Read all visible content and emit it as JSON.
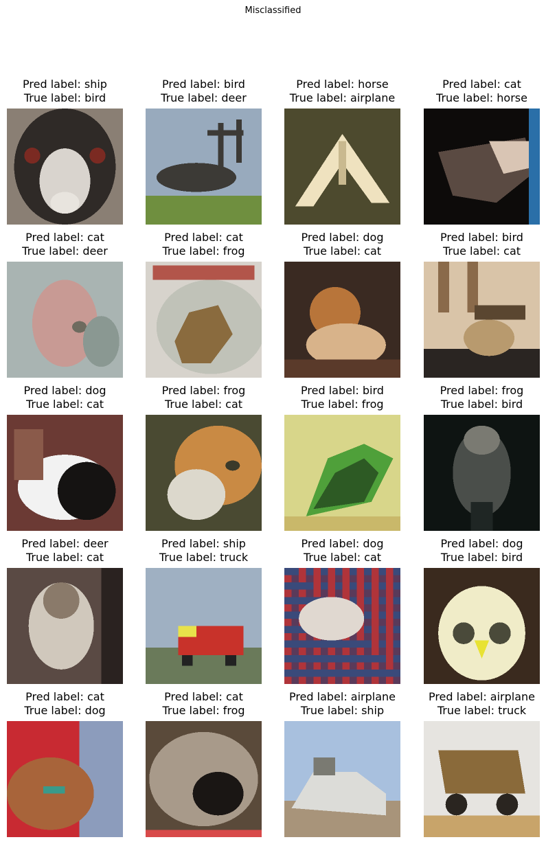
{
  "figure": {
    "title": "Misclassified"
  },
  "images": [
    {
      "pred": "Pred label: ship",
      "true": "True label: bird",
      "scene": "ostrich",
      "colors": [
        "#8a7f74",
        "#2f2a27",
        "#d9d4ce",
        "#7b2a22"
      ]
    },
    {
      "pred": "Pred label: bird",
      "true": "True label: deer",
      "scene": "deer-silhouette",
      "colors": [
        "#98aabd",
        "#3c3a36",
        "#6f8f3f",
        "#dfe4ea"
      ]
    },
    {
      "pred": "Pred label: horse",
      "true": "True label: airplane",
      "scene": "stealth-plane",
      "colors": [
        "#4d4a2e",
        "#efe2bf",
        "#6e6940",
        "#c9b98f"
      ]
    },
    {
      "pred": "Pred label: cat",
      "true": "True label: horse",
      "scene": "horse-head",
      "colors": [
        "#0d0b0a",
        "#5a4a42",
        "#d9c5b4",
        "#2a6fa8"
      ]
    },
    {
      "pred": "Pred label: cat",
      "true": "True label: deer",
      "scene": "deer-face",
      "colors": [
        "#a9b4b2",
        "#c89a94",
        "#8a9892",
        "#6e6b5f"
      ]
    },
    {
      "pred": "Pred label: cat",
      "true": "True label: frog",
      "scene": "frog-plate",
      "colors": [
        "#d7d3cc",
        "#8a6b3e",
        "#c0c2b8",
        "#b2554a"
      ]
    },
    {
      "pred": "Pred label: dog",
      "true": "True label: cat",
      "scene": "cat-sitting",
      "colors": [
        "#3a2a22",
        "#b8753a",
        "#d8b38a",
        "#5a3a2a"
      ]
    },
    {
      "pred": "Pred label: bird",
      "true": "True label: cat",
      "scene": "cat-window",
      "colors": [
        "#d9c4a8",
        "#5a4630",
        "#b89a6e",
        "#2a2522"
      ]
    },
    {
      "pred": "Pred label: dog",
      "true": "True label: cat",
      "scene": "cat-bw",
      "colors": [
        "#6b3a34",
        "#f2f2f2",
        "#151312",
        "#8a5a4a"
      ]
    },
    {
      "pred": "Pred label: frog",
      "true": "True label: cat",
      "scene": "cat-orange",
      "colors": [
        "#4a4a32",
        "#c98a44",
        "#dcd8cc",
        "#6a6a4a"
      ]
    },
    {
      "pred": "Pred label: bird",
      "true": "True label: frog",
      "scene": "frog-green",
      "colors": [
        "#d8d68a",
        "#4fa03a",
        "#2d5a24",
        "#c9b86a"
      ]
    },
    {
      "pred": "Pred label: frog",
      "true": "True label: bird",
      "scene": "hawk-dark",
      "colors": [
        "#0e1412",
        "#4a4e4a",
        "#7a7a72",
        "#1f2624"
      ]
    },
    {
      "pred": "Pred label: deer",
      "true": "True label: cat",
      "scene": "cat-grey",
      "colors": [
        "#5a4a44",
        "#d0c8bc",
        "#8a7a6a",
        "#2a2220"
      ]
    },
    {
      "pred": "Pred label: ship",
      "true": "True label: truck",
      "scene": "truck-red",
      "colors": [
        "#9fb0c2",
        "#c8322a",
        "#6a7a5a",
        "#e8e24a"
      ]
    },
    {
      "pred": "Pred label: dog",
      "true": "True label: cat",
      "scene": "cat-plaid",
      "colors": [
        "#5a3a5a",
        "#b0343a",
        "#e0d8d0",
        "#3a4a7a"
      ]
    },
    {
      "pred": "Pred label: dog",
      "true": "True label: bird",
      "scene": "owl",
      "colors": [
        "#3a2a1e",
        "#f0ecc8",
        "#e8e234",
        "#6a5a40"
      ]
    },
    {
      "pred": "Pred label: cat",
      "true": "True label: dog",
      "scene": "dog-red",
      "colors": [
        "#c82a32",
        "#a8643a",
        "#8c9cbc",
        "#3a9a8a"
      ]
    },
    {
      "pred": "Pred label: cat",
      "true": "True label: frog",
      "scene": "frog-close",
      "colors": [
        "#5a4a3a",
        "#a89a8a",
        "#1a1614",
        "#d84a4a"
      ]
    },
    {
      "pred": "Pred label: airplane",
      "true": "True label: ship",
      "scene": "ship-white",
      "colors": [
        "#a8c0de",
        "#dcdcd8",
        "#7a7a72",
        "#a8947a"
      ]
    },
    {
      "pred": "Pred label: airplane",
      "true": "True label: truck",
      "scene": "dump-truck",
      "colors": [
        "#e6e4e0",
        "#8a6a3a",
        "#2a2520",
        "#c8a46a"
      ]
    }
  ]
}
